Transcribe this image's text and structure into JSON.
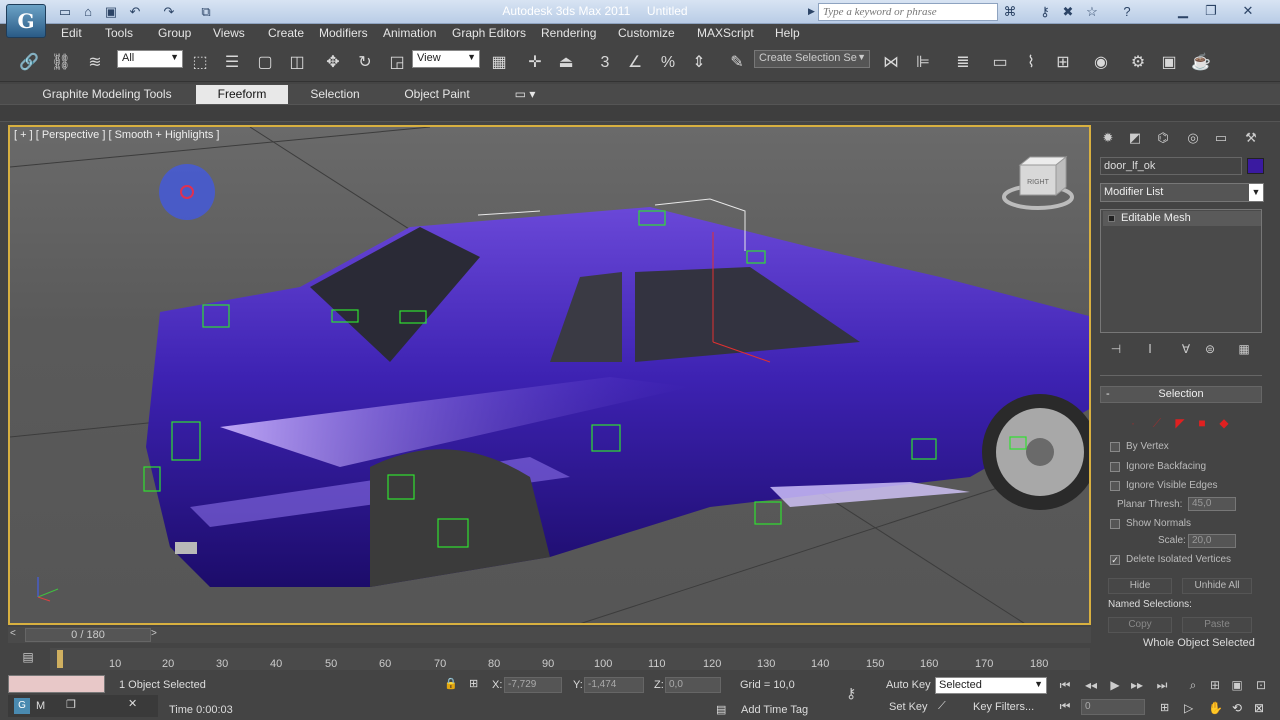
{
  "app": {
    "name": "Autodesk 3ds Max 2011",
    "doc": "Untitled"
  },
  "titlebar": {
    "search_placeholder": "Type a keyword or phrase"
  },
  "menus": [
    "Edit",
    "Tools",
    "Group",
    "Views",
    "Create",
    "Modifiers",
    "Animation",
    "Graph Editors",
    "Rendering",
    "Customize",
    "MAXScript",
    "Help"
  ],
  "toolbar": {
    "filter_value": "All",
    "coord_value": "View",
    "selection_set": "Create Selection Se"
  },
  "ribbon": {
    "tabs": [
      "Graphite Modeling Tools",
      "Freeform",
      "Selection",
      "Object Paint"
    ],
    "active": "Freeform"
  },
  "viewport": {
    "label": "[ + ] [ Perspective ] [ Smooth + Highlights ]",
    "viewcube_face": "RIGHT"
  },
  "command_panel": {
    "object_name": "door_lf_ok",
    "object_color": "#3a1aa0",
    "modifier_list": "Modifier List",
    "stack_item": "Editable Mesh",
    "rollout_title": "Selection",
    "options": {
      "by_vertex": "By Vertex",
      "ignore_backfacing": "Ignore Backfacing",
      "ignore_visible_edges": "Ignore Visible Edges",
      "planar_thresh_label": "Planar Thresh:",
      "planar_thresh_value": "45,0",
      "show_normals": "Show Normals",
      "scale_label": "Scale:",
      "scale_value": "20,0",
      "delete_isolated": "Delete Isolated Vertices"
    },
    "delete_isolated_checked": true,
    "buttons": {
      "hide": "Hide",
      "unhide_all": "Unhide All",
      "copy": "Copy",
      "paste": "Paste"
    },
    "named_selections": "Named Selections:",
    "status": "Whole Object Selected"
  },
  "timeline": {
    "position": "0 / 180",
    "ticks": [
      "10",
      "20",
      "30",
      "40",
      "50",
      "60",
      "70",
      "80",
      "90",
      "100",
      "110",
      "120",
      "130",
      "140",
      "150",
      "160",
      "170",
      "180"
    ]
  },
  "status": {
    "selection": "1 Object Selected",
    "x_label": "X:",
    "x_value": "-7,729",
    "y_label": "Y:",
    "y_value": "-1,474",
    "z_label": "Z:",
    "z_value": "0,0",
    "grid": "Grid = 10,0",
    "time": "Time  0:00:03",
    "add_time_tag": "Add Time Tag",
    "auto_key": "Auto Key",
    "set_key": "Set Key",
    "key_mode": "Selected",
    "key_filters": "Key Filters...",
    "frame": "0"
  },
  "taskbar": {
    "app_letter": "M"
  }
}
